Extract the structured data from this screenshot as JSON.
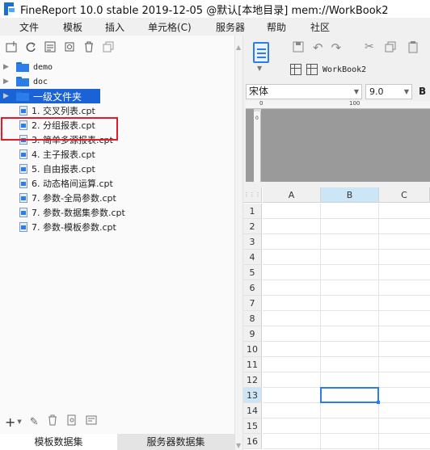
{
  "title": "FineReport 10.0 stable 2019-12-05 @默认[本地目录]    mem://WorkBook2",
  "menu": [
    "文件",
    "模板",
    "插入",
    "单元格(C)",
    "服务器",
    "帮助",
    "社区"
  ],
  "tree": {
    "folders": [
      {
        "label": "demo"
      },
      {
        "label": "doc"
      },
      {
        "label": "一级文件夹",
        "selected": true
      }
    ],
    "files": [
      "1. 交叉列表.cpt",
      "2. 分组报表.cpt",
      "3. 简单多源报表.cpt",
      "4. 主子报表.cpt",
      "5. 自由报表.cpt",
      "6. 动态格间运算.cpt",
      "7. 参数-全局参数.cpt",
      "7. 参数-数据集参数.cpt",
      "7. 参数-模板参数.cpt"
    ]
  },
  "bottom_tabs": {
    "template_data": "模板数据集",
    "server_data": "服务器数据集"
  },
  "workbook": {
    "name": "WorkBook2"
  },
  "font": {
    "family": "宋体",
    "size": "9.0",
    "bold_label": "B"
  },
  "ruler": {
    "h_labels": [
      "0",
      "100"
    ],
    "v_label": "0"
  },
  "sheet": {
    "columns": [
      "A",
      "B",
      "C"
    ],
    "rows": [
      "1",
      "2",
      "3",
      "4",
      "5",
      "6",
      "7",
      "8",
      "9",
      "10",
      "11",
      "12",
      "13",
      "14",
      "15",
      "16"
    ],
    "selected_cell": "B13"
  },
  "colors": {
    "accent": "#2b7de9",
    "selection": "#1a63d6",
    "highlight_box": "#e11d2a"
  }
}
